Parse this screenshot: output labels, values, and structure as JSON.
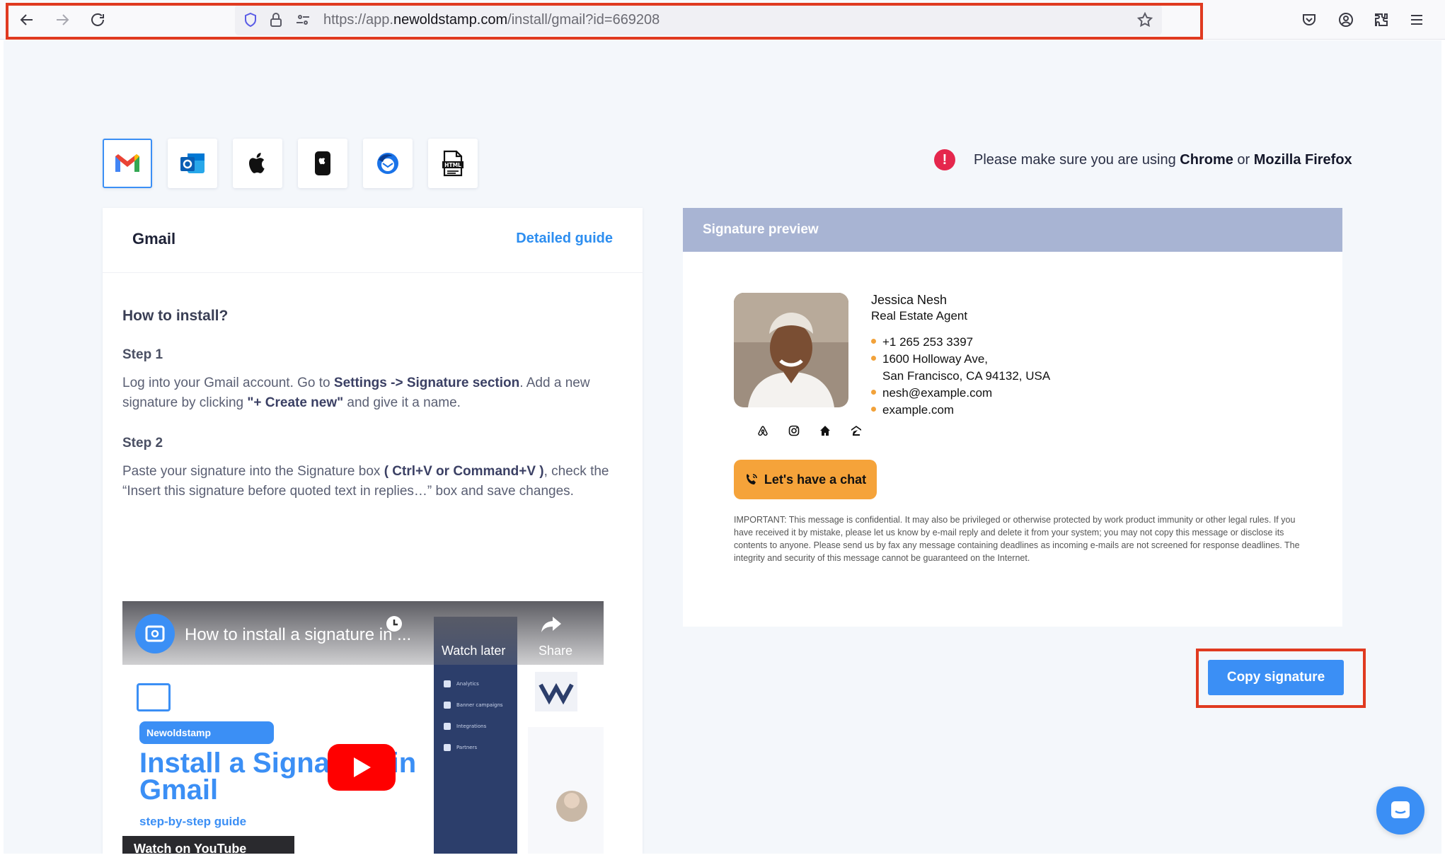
{
  "browser": {
    "url_prefix": "https://app.",
    "url_domain": "newoldstamp.com",
    "url_path": "/install/gmail?id=669208"
  },
  "clients": [
    {
      "name": "gmail",
      "active": true
    },
    {
      "name": "outlook",
      "active": false
    },
    {
      "name": "apple-mail",
      "active": false
    },
    {
      "name": "ios-mail",
      "active": false
    },
    {
      "name": "thunderbird",
      "active": false
    },
    {
      "name": "html",
      "active": false
    }
  ],
  "notice": {
    "text_before": "Please make sure you are using ",
    "browser_1": "Chrome",
    "text_between": " or ",
    "browser_2": "Mozilla Firefox"
  },
  "guide": {
    "title": "Gmail",
    "detailed_guide_link": "Detailed guide",
    "heading": "How to install?",
    "step1_label": "Step 1",
    "step1_a": "Log into your Gmail account. Go to ",
    "step1_b": "Settings -> Signature section",
    "step1_c": ". Add a new signature by clicking ",
    "step1_d": "\"+ Create new\"",
    "step1_e": " and give it a name.",
    "step2_label": "Step 2",
    "step2_a": "Paste your signature into the Signature box ",
    "step2_b": "( Ctrl+V or Command+V )",
    "step2_c": ", check the “Insert this signature before quoted text in replies…” box and save changes."
  },
  "video": {
    "title": "How to install a signature in ...",
    "watch_later": "Watch later",
    "share": "Share",
    "brand_pill": "Newoldstamp",
    "headline": "Install a Signature in Gmail",
    "subline": "step-by-step guide",
    "sidebar_items": [
      "Analytics",
      "Banner campaigns",
      "Integrations",
      "Partners"
    ],
    "watch_on": "Watch on YouTube"
  },
  "preview": {
    "header": "Signature preview",
    "name": "Jessica Nesh",
    "role": "Real Estate Agent",
    "phone": "+1 265 253 3397",
    "address_1": "1600 Holloway Ave,",
    "address_2": "San Francisco, CA 94132, USA",
    "email": "nesh@example.com",
    "website": "example.com",
    "social_icons": [
      "airbnb-icon",
      "instagram-icon",
      "home-icon",
      "zillow-icon"
    ],
    "cta_button": "Let's have a chat",
    "disclaimer": "IMPORTANT: This message is confidential. It may also be privileged or otherwise protected by work product immunity or other legal rules. If you have received it by mistake, please let us know by e-mail reply and delete it from your system; you may not copy this message or disclose its contents to anyone. Please send us by fax any message containing deadlines as incoming e-mails are not screened for response deadlines. The integrity and security of this message cannot be guaranteed on the Internet."
  },
  "copy_button": "Copy signature",
  "colors": {
    "accent": "#3b8ff5",
    "cta": "#f5a33a",
    "highlight_box": "#e03a20",
    "notice": "#e5274d"
  }
}
